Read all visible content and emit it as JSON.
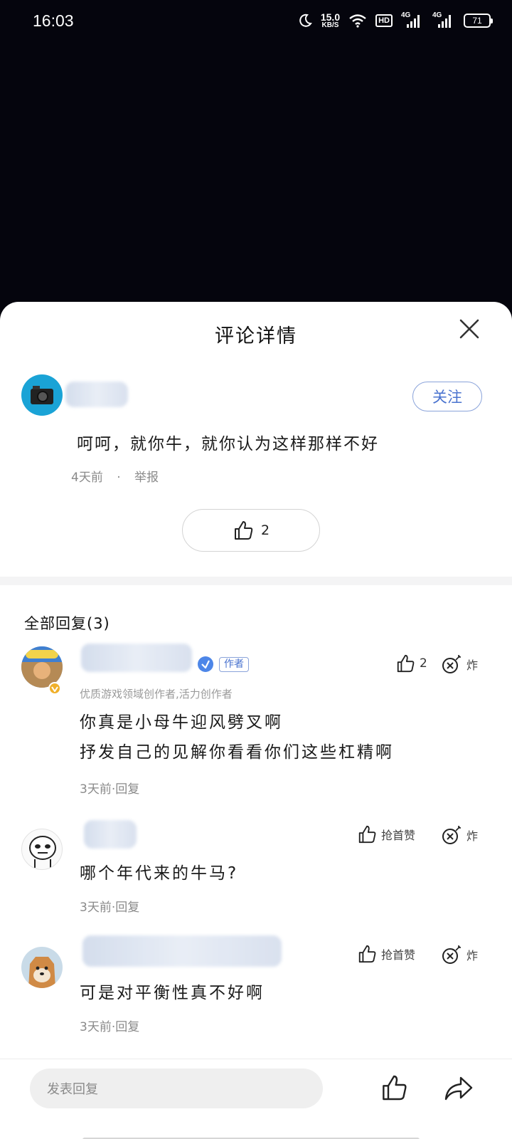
{
  "status_bar": {
    "time": "16:03",
    "net_speed": "15.0",
    "net_unit": "KB/S",
    "hd": "HD",
    "signal_1": "4G",
    "signal_2": "4G",
    "battery": "71",
    "icons": [
      "moon-icon",
      "wifi-icon",
      "signal-icon",
      "battery-icon"
    ]
  },
  "sheet": {
    "title": "评论详情",
    "close_icon": "close-icon"
  },
  "main_comment": {
    "follow_label": "关注",
    "text": "呵呵，就你牛，就你认为这样那样不好",
    "time": "4天前",
    "separator": "·",
    "report": "举报",
    "like_count": "2"
  },
  "replies": {
    "title": "全部回复(3)",
    "items": [
      {
        "tag": "作者",
        "creator_desc": "优质游戏领域创作者,活力创作者",
        "text_line1": "你真是小母牛迎风劈叉啊",
        "text_line2": "抒发自己的见解你看看你们这些杠精啊",
        "meta": "3天前·回复",
        "like": "2",
        "bomb": "炸"
      },
      {
        "text_line1": "哪个年代来的牛马?",
        "meta": "3天前·回复",
        "like": "抢首赞",
        "bomb": "炸"
      },
      {
        "text_line1": "可是对平衡性真不好啊",
        "meta": "3天前·回复",
        "like": "抢首赞",
        "bomb": "炸"
      }
    ]
  },
  "bottom_bar": {
    "placeholder": "发表回复"
  },
  "colors": {
    "accent": "#4a73cf",
    "background_dark": "#05050d",
    "divider": "#f4f4f5"
  }
}
